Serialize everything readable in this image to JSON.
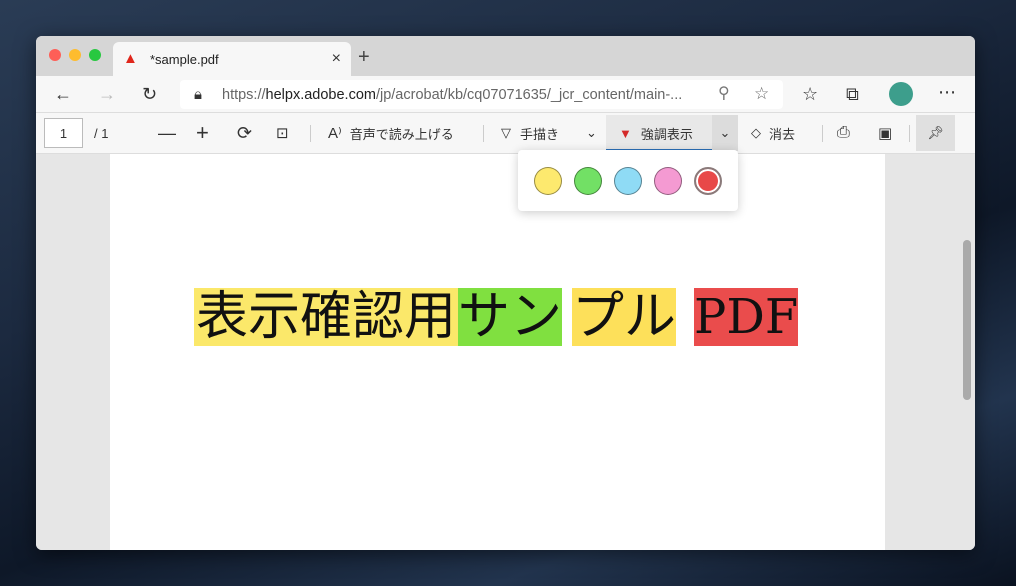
{
  "tab": {
    "title": "*sample.pdf",
    "close": "×",
    "new_tab": "+"
  },
  "address": {
    "url_prefix": "https://",
    "url_host": "helpx.adobe.com",
    "url_path": "/jp/acrobat/kb/cq07071635/_jcr_content/main-..."
  },
  "pdf_toolbar": {
    "page_current": "1",
    "page_total": "/ 1",
    "read_aloud": "音声で読み上げる",
    "draw": "手描き",
    "highlight": "強調表示",
    "erase": "消去"
  },
  "document": {
    "segments": [
      {
        "text": "表示確認用",
        "color": "#fbe86a"
      },
      {
        "text": "サン",
        "color": "#80e040"
      },
      {
        "text": "プル",
        "color": "#fde05a"
      },
      {
        "text": "PDF",
        "color": "#ea4c4c"
      }
    ]
  },
  "highlight_colors": [
    {
      "name": "yellow",
      "color": "#fde96e",
      "selected": false
    },
    {
      "name": "green",
      "color": "#72e065",
      "selected": false
    },
    {
      "name": "blue",
      "color": "#8fdbf5",
      "selected": false
    },
    {
      "name": "pink",
      "color": "#f49ad2",
      "selected": false
    },
    {
      "name": "red",
      "color": "#e84848",
      "selected": true
    }
  ]
}
